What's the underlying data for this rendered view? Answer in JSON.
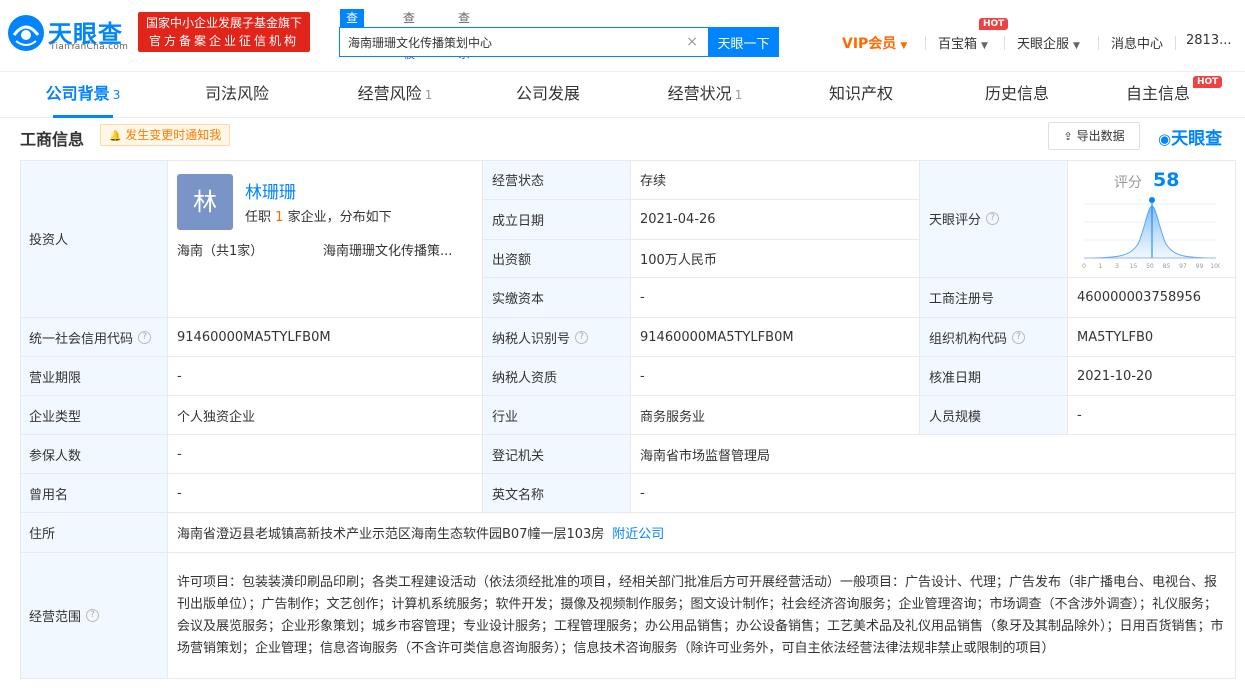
{
  "header": {
    "logo_text": "天眼查",
    "logo_sub": "TianYanCha.com",
    "promo_line1": "国家中小企业发展子基金旗下",
    "promo_line2": "官方备案企业征信机构",
    "search_tabs": [
      "查公司",
      "查老板",
      "查关系"
    ],
    "search_value": "海南珊珊文化传播策划中心",
    "search_button": "天眼一下",
    "nav": {
      "vip": "VIP会员",
      "treasure": "百宝箱",
      "enterprise": "天眼企服",
      "messages": "消息中心",
      "user": "2813..."
    },
    "hot_badge": "HOT"
  },
  "tabs": [
    {
      "label": "公司背景",
      "count": "3"
    },
    {
      "label": "司法风险",
      "count": ""
    },
    {
      "label": "经营风险",
      "count": "1"
    },
    {
      "label": "公司发展",
      "count": ""
    },
    {
      "label": "经营状况",
      "count": "1"
    },
    {
      "label": "知识产权",
      "count": ""
    },
    {
      "label": "历史信息",
      "count": ""
    },
    {
      "label": "自主信息",
      "count": ""
    }
  ],
  "section": {
    "title": "工商信息",
    "notify": "发生变更时通知我",
    "export": "导出数据",
    "brand": "天眼查"
  },
  "investor": {
    "label": "投资人",
    "avatar": "林",
    "name": "林珊珊",
    "sub_prefix": "任职",
    "sub_count": "1",
    "sub_suffix": "家企业，分布如下",
    "region": "海南（共1家）",
    "company": "海南珊珊文化传播策..."
  },
  "score": {
    "label": "天眼评分",
    "score_word": "评分",
    "value": "58",
    "axis": [
      "0",
      "1",
      "3",
      "15",
      "50",
      "85",
      "97",
      "99",
      "100"
    ]
  },
  "fields": {
    "status_label": "经营状态",
    "status": "存续",
    "founded_label": "成立日期",
    "founded": "2021-04-26",
    "capital_label": "出资额",
    "capital": "100万人民币",
    "paid_label": "实缴资本",
    "paid": "-",
    "reg_no_label": "工商注册号",
    "reg_no": "460000003758956",
    "credit_code_label": "统一社会信用代码",
    "credit_code": "91460000MA5TYLFB0M",
    "tax_id_label": "纳税人识别号",
    "tax_id": "91460000MA5TYLFB0M",
    "org_code_label": "组织机构代码",
    "org_code": "MA5TYLFB0",
    "term_label": "营业期限",
    "term": "-",
    "tax_qual_label": "纳税人资质",
    "tax_qual": "-",
    "approved_label": "核准日期",
    "approved": "2021-10-20",
    "type_label": "企业类型",
    "type": "个人独资企业",
    "industry_label": "行业",
    "industry": "商务服务业",
    "staff_label": "人员规模",
    "staff": "-",
    "insured_label": "参保人数",
    "insured": "-",
    "authority_label": "登记机关",
    "authority": "海南省市场监督管理局",
    "former_label": "曾用名",
    "former": "-",
    "english_label": "英文名称",
    "english": "-",
    "address_label": "住所",
    "address": "海南省澄迈县老城镇高新技术产业示范区海南生态软件园B07幢一层103房",
    "nearby": "附近公司",
    "scope_label": "经营范围",
    "scope": "许可项目：包装装潢印刷品印刷；各类工程建设活动（依法须经批准的项目，经相关部门批准后方可开展经营活动）一般项目：广告设计、代理；广告发布（非广播电台、电视台、报刊出版单位）；广告制作；文艺创作；计算机系统服务；软件开发；摄像及视频制作服务；图文设计制作；社会经济咨询服务；企业管理咨询；市场调查（不含涉外调查）；礼仪服务；会议及展览服务；企业形象策划；城乡市容管理；专业设计服务；工程管理服务；办公用品销售；办公设备销售；工艺美术品及礼仪用品销售（象牙及其制品除外）；日用百货销售；市场营销策划；企业管理；信息咨询服务（不含许可类信息咨询服务）；信息技术咨询服务（除许可业务外，可自主依法经营法律法规非禁止或限制的项目）"
  },
  "colors": {
    "accent": "#0084ff",
    "label_bg": "#f2f8ff",
    "promo_red": "#e1251b",
    "vip_orange": "#ff6a00"
  }
}
